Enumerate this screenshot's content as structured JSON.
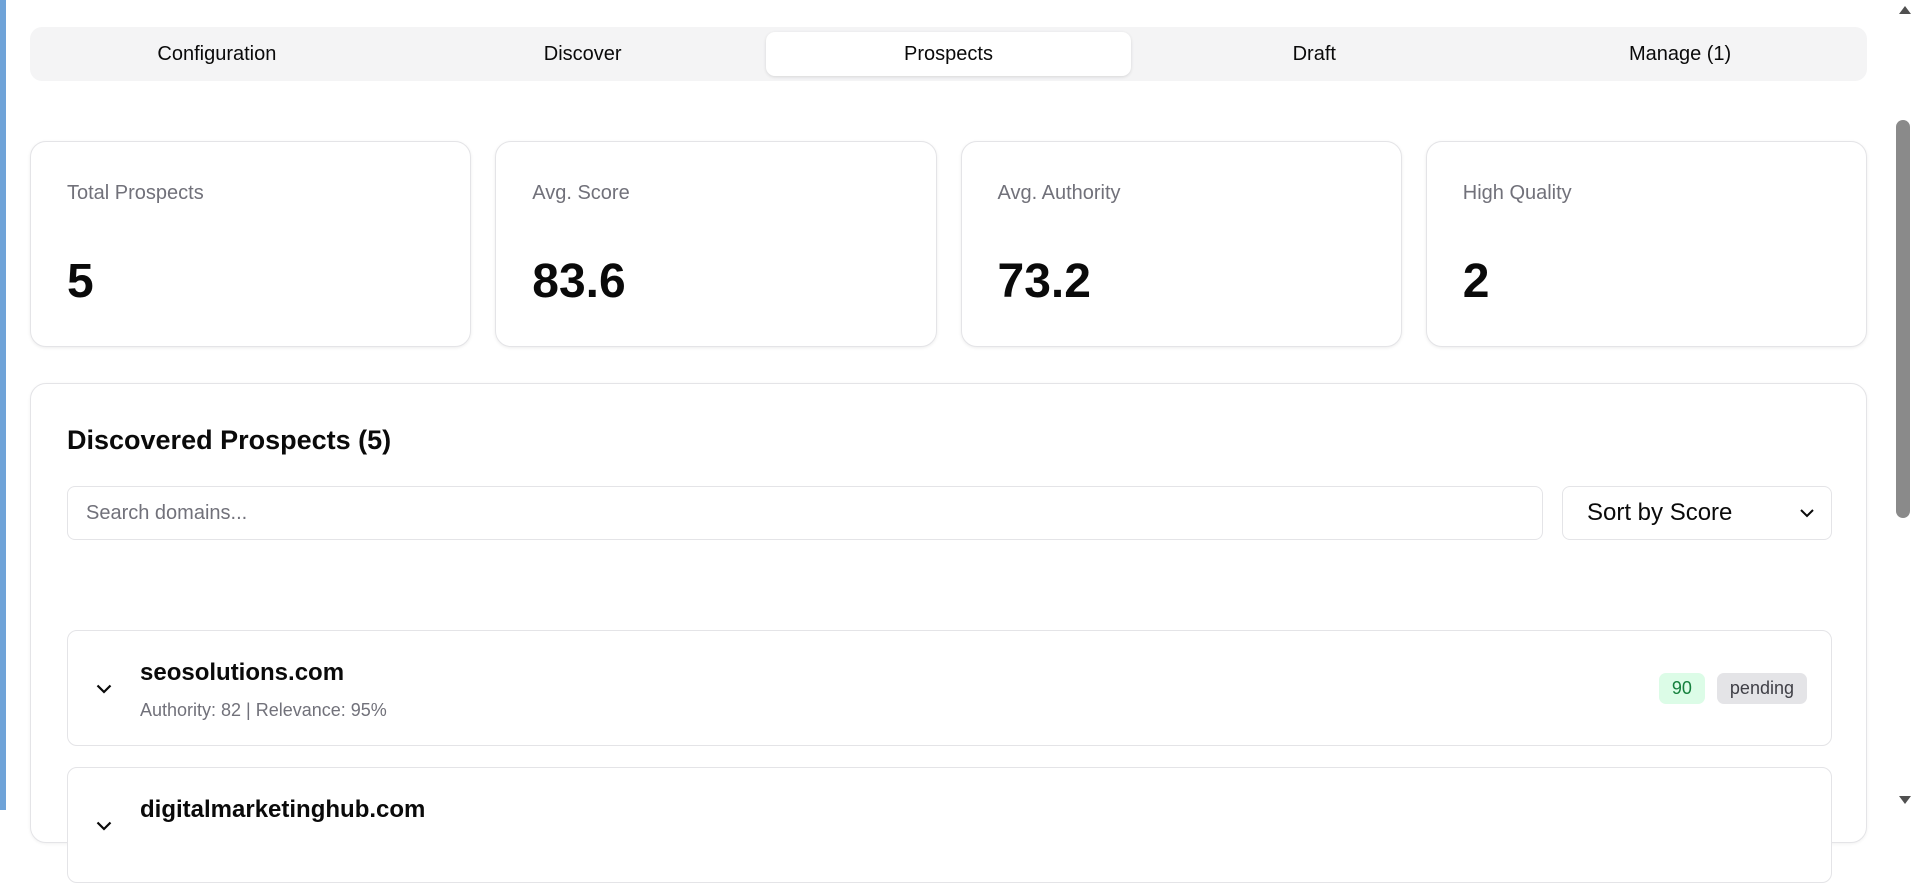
{
  "tabs": [
    {
      "label": "Configuration",
      "active": false
    },
    {
      "label": "Discover",
      "active": false
    },
    {
      "label": "Prospects",
      "active": true
    },
    {
      "label": "Draft",
      "active": false
    },
    {
      "label": "Manage (1)",
      "active": false
    }
  ],
  "stats": [
    {
      "label": "Total Prospects",
      "value": "5"
    },
    {
      "label": "Avg. Score",
      "value": "83.6"
    },
    {
      "label": "Avg. Authority",
      "value": "73.2"
    },
    {
      "label": "High Quality",
      "value": "2"
    }
  ],
  "prospects_panel": {
    "title": "Discovered Prospects (5)",
    "search_placeholder": "Search domains...",
    "search_value": "",
    "sort_selected": "Sort by Score"
  },
  "prospects": [
    {
      "domain": "seosolutions.com",
      "meta": "Authority: 82 | Relevance: 95%",
      "score": "90",
      "status": "pending",
      "expand_icon": "chevron-down-icon"
    },
    {
      "domain": "digitalmarketinghub.com",
      "meta": "",
      "score": "",
      "status": "",
      "expand_icon": "chevron-down-icon"
    }
  ],
  "colors": {
    "score_badge_bg": "#dcfce7",
    "score_badge_text": "#15803d",
    "status_badge_bg": "#e4e4e7",
    "left_accent": "#6fa3d8"
  }
}
